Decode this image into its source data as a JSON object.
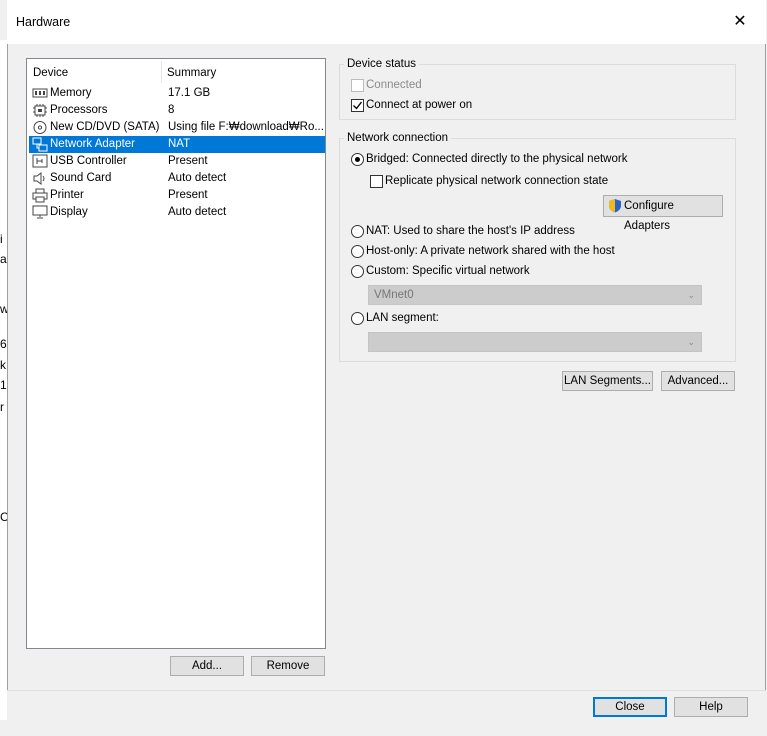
{
  "window": {
    "title": "Hardware",
    "close_glyph": "✕"
  },
  "background_fragments": [
    "i",
    "a",
    "w",
    "6",
    "k",
    "1",
    "r",
    "C"
  ],
  "device_list": {
    "headers": {
      "device": "Device",
      "summary": "Summary"
    },
    "rows": [
      {
        "icon": "memory-icon",
        "name": "Memory",
        "summary": "17.1 GB"
      },
      {
        "icon": "processor-icon",
        "name": "Processors",
        "summary": "8"
      },
      {
        "icon": "cd-dvd-icon",
        "name": "New CD/DVD (SATA)",
        "summary": "Using file F:₩download₩Ro..."
      },
      {
        "icon": "network-adapter-icon",
        "name": "Network Adapter",
        "summary": "NAT",
        "selected": true
      },
      {
        "icon": "usb-icon",
        "name": "USB Controller",
        "summary": "Present"
      },
      {
        "icon": "sound-icon",
        "name": "Sound Card",
        "summary": "Auto detect"
      },
      {
        "icon": "printer-icon",
        "name": "Printer",
        "summary": "Present"
      },
      {
        "icon": "display-icon",
        "name": "Display",
        "summary": "Auto detect"
      }
    ],
    "add_label": "Add...",
    "remove_label": "Remove"
  },
  "device_status": {
    "title": "Device status",
    "connected_label": "Connected",
    "connected_checked": false,
    "connected_disabled": true,
    "connect_power_label": "Connect at power on",
    "connect_power_checked": true
  },
  "network_connection": {
    "title": "Network connection",
    "bridged_label": "Bridged: Connected directly to the physical network",
    "replicate_label": "Replicate physical network connection state",
    "configure_label": "Configure Adapters",
    "nat_label": "NAT: Used to share the host's IP address",
    "hostonly_label": "Host-only: A private network shared with the host",
    "custom_label": "Custom: Specific virtual network",
    "custom_value": "VMnet0",
    "lan_label": "LAN segment:",
    "lan_value": "",
    "selected": "bridged"
  },
  "buttons": {
    "lan_segments": "LAN Segments...",
    "advanced": "Advanced...",
    "close": "Close",
    "help": "Help"
  },
  "colors": {
    "selection": "#0078d7",
    "primary_border": "#0078d7"
  }
}
